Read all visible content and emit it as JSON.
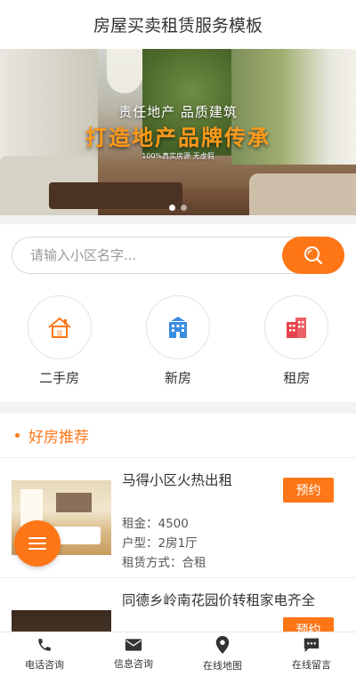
{
  "header": {
    "title": "房屋买卖租赁服务模板"
  },
  "banner": {
    "line1": "责任地产  品质建筑",
    "line2": "打造地产品牌传承",
    "line3": "100%真实房源 无虚假",
    "dots": 2,
    "active_dot": 0
  },
  "search": {
    "placeholder": "请输入小区名字..."
  },
  "categories": [
    {
      "label": "二手房",
      "icon": "house-icon",
      "color": "#ff7617"
    },
    {
      "label": "新房",
      "icon": "building-icon",
      "color": "#3b8de0"
    },
    {
      "label": "租房",
      "icon": "apartment-icon",
      "color": "#e8434b"
    }
  ],
  "recommend": {
    "title": "好房推荐",
    "items": [
      {
        "name": "马得小区火热出租",
        "rent": "租金：4500",
        "layout": "户型：2房1厅",
        "rent_type": "租赁方式：合租",
        "book_label": "预约"
      },
      {
        "name": "同德乡岭南花园价转租家电齐全",
        "book_label": "预约"
      }
    ]
  },
  "tabbar": [
    {
      "label": "电话咨询",
      "icon": "phone-icon"
    },
    {
      "label": "信息咨询",
      "icon": "mail-icon"
    },
    {
      "label": "在线地图",
      "icon": "map-pin-icon"
    },
    {
      "label": "在线留言",
      "icon": "message-icon"
    }
  ],
  "colors": {
    "accent": "#ff7617"
  }
}
